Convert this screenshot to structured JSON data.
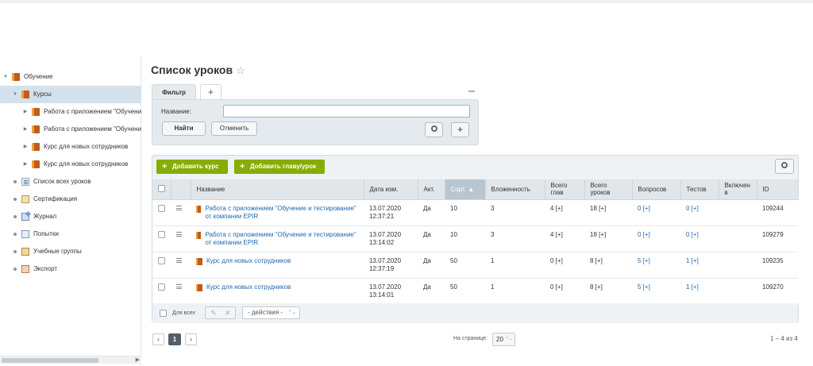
{
  "sidebar": {
    "items": [
      {
        "label": "Обучение",
        "icon": "book-icon",
        "arrow": "▼"
      },
      {
        "label": "Курсы",
        "icon": "book-icon",
        "arrow": "▼"
      },
      {
        "label": "Работа с приложением \"Обучени",
        "icon": "book-icon",
        "arrow": "▶"
      },
      {
        "label": "Работа с приложением \"Обучени",
        "icon": "book-icon",
        "arrow": "▶"
      },
      {
        "label": "Курс для новых сотрудников",
        "icon": "book-icon",
        "arrow": "▶"
      },
      {
        "label": "Курс для новых сотрудников",
        "icon": "book-icon",
        "arrow": "▶"
      },
      {
        "label": "Список всех уроков",
        "icon": "list-icon"
      },
      {
        "label": "Сертификация",
        "icon": "certificate-icon"
      },
      {
        "label": "Журнал",
        "icon": "journal-icon"
      },
      {
        "label": "Попытки",
        "icon": "attempts-icon"
      },
      {
        "label": "Учебные группы",
        "icon": "groups-icon"
      },
      {
        "label": "Экспорт",
        "icon": "export-icon"
      }
    ]
  },
  "page": {
    "title": "Список уроков",
    "star": "☆"
  },
  "filter": {
    "tab_label": "Фильтр",
    "add_tab": "+",
    "name_label": "Название:",
    "name_value": "",
    "find_button": "Найти",
    "cancel_button": "Отменить",
    "plus": "+"
  },
  "toolbar": {
    "add_course": "Добавить курс",
    "add_chapter": "Добавить главу/урок"
  },
  "table": {
    "headers": {
      "name": "Название",
      "date": "Дата изм.",
      "active": "Акт.",
      "sort": "Сорт. ▲",
      "nesting": "Вложенность",
      "chapters": "Всего глав",
      "lessons": "Всего уроков",
      "questions": "Вопросов",
      "tests": "Тестов",
      "included": "Включен в",
      "id": "ID"
    },
    "rows": [
      {
        "name": "Работа с приложением \"Обучение и тестирование\" от компании EPIR",
        "date": "13.07.2020",
        "time": "12:37:21",
        "active": "Да",
        "sort": "10",
        "nesting": "3",
        "chapters": "4 [+]",
        "lessons": "18 [+]",
        "questions": "0 [+]",
        "tests": "0 [+]",
        "included": "",
        "id": "109244"
      },
      {
        "name": "Работа с приложением \"Обучение и тестирование\" от компании EPIR",
        "date": "13.07.2020",
        "time": "13:14:02",
        "active": "Да",
        "sort": "10",
        "nesting": "3",
        "chapters": "4 [+]",
        "lessons": "18 [+]",
        "questions": "0 [+]",
        "tests": "0 [+]",
        "included": "",
        "id": "109279"
      },
      {
        "name": "Курс для новых сотрудников",
        "date": "13.07.2020",
        "time": "12:37:19",
        "active": "Да",
        "sort": "50",
        "nesting": "1",
        "chapters": "0 [+]",
        "lessons": "8 [+]",
        "questions": "5 [+]",
        "tests": "1 [+]",
        "included": "",
        "id": "109235"
      },
      {
        "name": "Курс для новых сотрудников",
        "date": "13.07.2020",
        "time": "13:14:01",
        "active": "Да",
        "sort": "50",
        "nesting": "1",
        "chapters": "0 [+]",
        "lessons": "8 [+]",
        "questions": "5 [+]",
        "tests": "1 [+]",
        "included": "",
        "id": "109270"
      }
    ]
  },
  "footer": {
    "for_all": "Для всех",
    "actions": "- действия -",
    "edit_icon": "✎",
    "delete_icon": "✕"
  },
  "pagination": {
    "prev": "‹",
    "current": "1",
    "next": "›",
    "per_page_label": "На странице:",
    "per_page": "20",
    "count": "1 – 4 из 4"
  }
}
